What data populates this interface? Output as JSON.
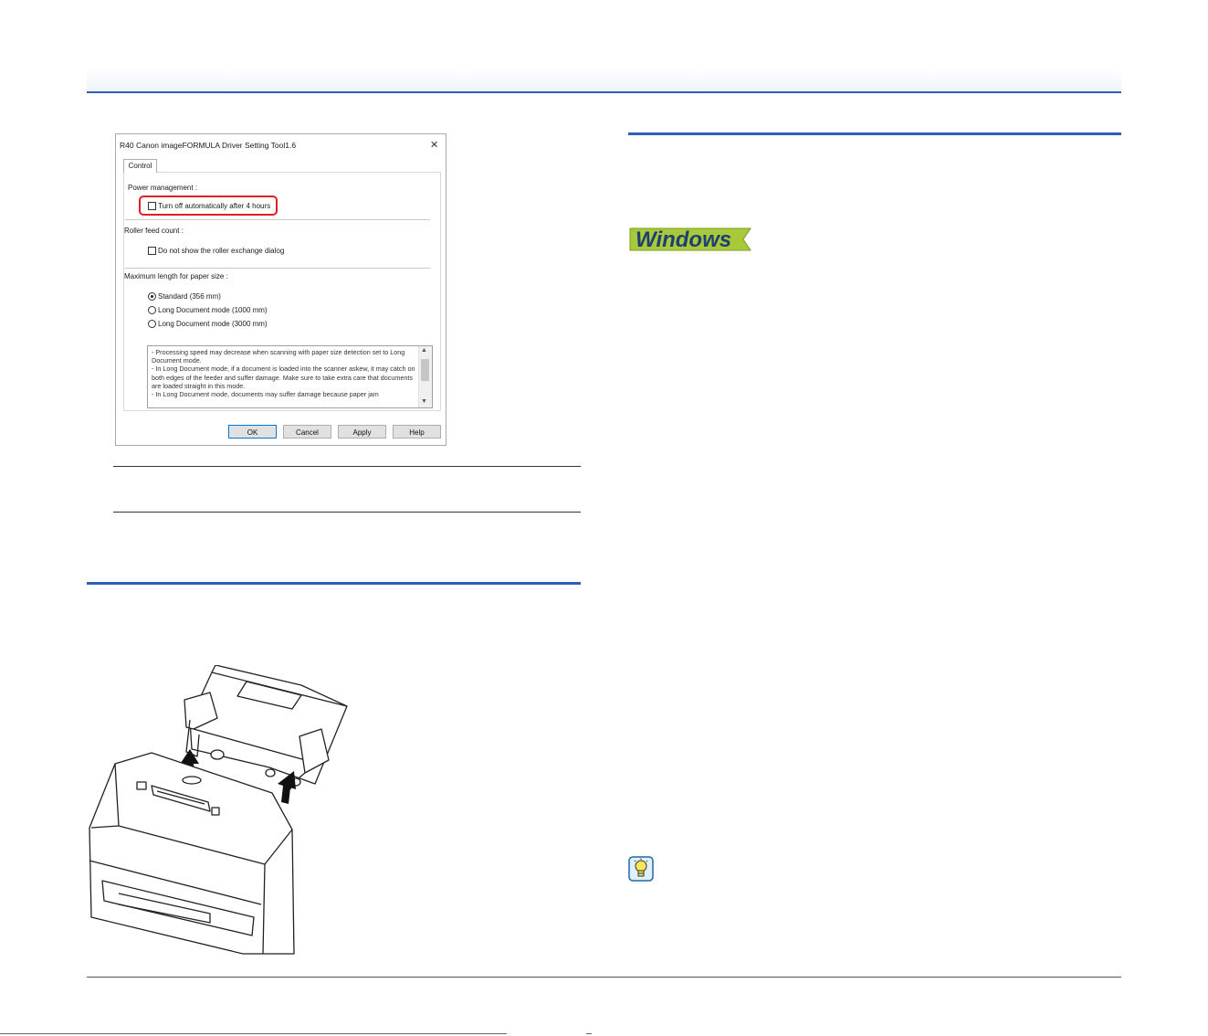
{
  "dialog": {
    "title": "R40 Canon imageFORMULA Driver Setting Tool1.6",
    "close_glyph": "✕",
    "tab_label": "Control",
    "power_management_label": "Power management :",
    "auto_off_label": "Turn off automatically after 4 hours",
    "auto_off_checked": false,
    "roller_feed_label": "Roller feed count :",
    "roller_dialog_label": "Do not show the roller exchange dialog",
    "roller_dialog_checked": false,
    "max_length_label": "Maximum length for paper size :",
    "paper_options": [
      {
        "label": "Standard (356 mm)",
        "selected": true
      },
      {
        "label": "Long Document mode (1000 mm)",
        "selected": false
      },
      {
        "label": "Long Document mode (3000 mm)",
        "selected": false
      }
    ],
    "notes": [
      "- Processing speed may decrease when scanning with paper size detection set to Long Document mode.",
      "- In Long Document mode, if a document is loaded into the scanner askew, it may catch on both edges of the feeder and suffer damage. Make sure to take extra care that documents are loaded straight in this mode.",
      "- In Long Document mode, documents may suffer damage because paper jam"
    ],
    "buttons": {
      "ok": "OK",
      "cancel": "Cancel",
      "apply": "Apply",
      "help": "Help"
    }
  },
  "windows_badge": {
    "text": "Windows",
    "colors": {
      "background": "#a7c93a",
      "text": "#1f3f73"
    }
  },
  "icons": {
    "hint": "lightbulb-icon",
    "scanner": "scanner-illustration"
  },
  "colors": {
    "accent_rule": "#2c5fb8",
    "highlight": "#e02020"
  }
}
